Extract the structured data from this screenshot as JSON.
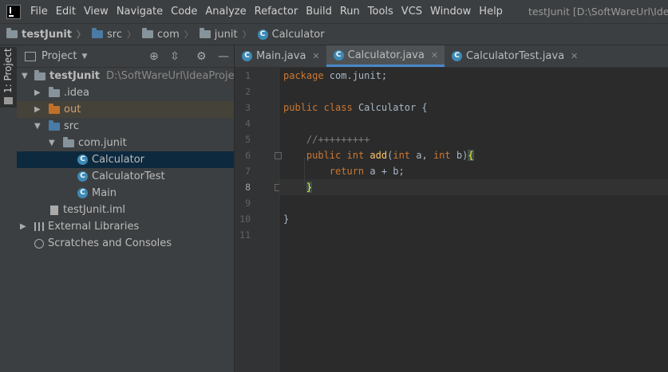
{
  "menubar": {
    "items": [
      "File",
      "Edit",
      "View",
      "Navigate",
      "Code",
      "Analyze",
      "Refactor",
      "Build",
      "Run",
      "Tools",
      "VCS",
      "Window",
      "Help"
    ],
    "title": "testJunit [D:\\SoftWareUrl\\IdeaPro"
  },
  "breadcrumb": {
    "project": "testJunit",
    "folder1": "src",
    "folder2": "com",
    "folder3": "junit",
    "file": "Calculator"
  },
  "left_strip": {
    "tab": "1: Project"
  },
  "project_panel": {
    "header": "Project",
    "tree": {
      "root": "testJunit",
      "root_path": "D:\\SoftWareUrl\\IdeaProjects\\t",
      "idea": ".idea",
      "out": "out",
      "src": "src",
      "package": "com.junit",
      "class1": "Calculator",
      "class2": "CalculatorTest",
      "class3": "Main",
      "iml": "testJunit.iml",
      "libs": "External Libraries",
      "scratches": "Scratches and Consoles"
    }
  },
  "editor": {
    "tabs": [
      "Main.java",
      "Calculator.java",
      "CalculatorTest.java"
    ],
    "active_tab": 1,
    "current_line": 8,
    "line_numbers": [
      "1",
      "2",
      "3",
      "4",
      "5",
      "6",
      "7",
      "8",
      "9",
      "10",
      "11"
    ],
    "code": {
      "l1_kw": "package",
      "l1_rest": " com.junit;",
      "l3_kw1": "public",
      "l3_kw2": "class",
      "l3_rest": " Calculator {",
      "l5_comment": "//+++++++++",
      "l6_kw1": "public",
      "l6_kw2": "int",
      "l6_fn": "add",
      "l6_p1": "(",
      "l6_kw3": "int",
      "l6_p2": " a, ",
      "l6_kw4": "int",
      "l6_p3": " b)",
      "l6_brace": "{",
      "l7_kw": "return",
      "l7_rest": " a + b;",
      "l8_brace": "}",
      "l10_brace": "}"
    }
  },
  "colors": {
    "background": "#2b2b2b",
    "panel": "#3c3f41",
    "keyword": "#cc7832",
    "function": "#ffc66d",
    "comment": "#808080",
    "selection": "#0d293e",
    "tab_underline": "#4a88c7"
  }
}
